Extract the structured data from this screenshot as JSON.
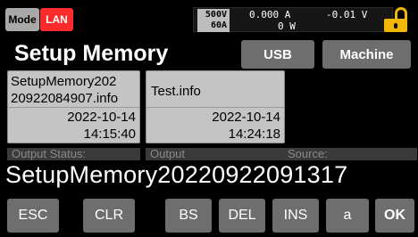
{
  "status_bar": {
    "mode_label": "Mode",
    "lan_label": "LAN",
    "set_voltage": "500V",
    "set_current": "60A",
    "meas_current": "0.000 A",
    "meas_voltage": "-0.01 V",
    "meas_power": "0 W"
  },
  "page": {
    "title": "Setup Memory",
    "usb_label": "USB",
    "machine_label": "Machine"
  },
  "files": [
    {
      "name_line1": "SetupMemory202",
      "name_line2": "20922084907.info",
      "date": "2022-10-14",
      "time": "14:15:40"
    },
    {
      "name_line1": "Test.info",
      "name_line2": "",
      "date": "2022-10-14",
      "time": "14:24:18"
    }
  ],
  "partial_row": [
    "Output Status:",
    "Output",
    "Source:"
  ],
  "keyboard": {
    "entry_text": "SetupMemory20220922091317",
    "keys": {
      "esc": "ESC",
      "clr": "CLR",
      "bs": "BS",
      "del": "DEL",
      "ins": "INS",
      "case": "a",
      "ok": "OK"
    }
  },
  "colors": {
    "lan_red": "#ff2a2a",
    "lock_yellow": "#f2b705",
    "button_gray": "#6e6e6e",
    "tile_gray": "#c4c4c4"
  }
}
